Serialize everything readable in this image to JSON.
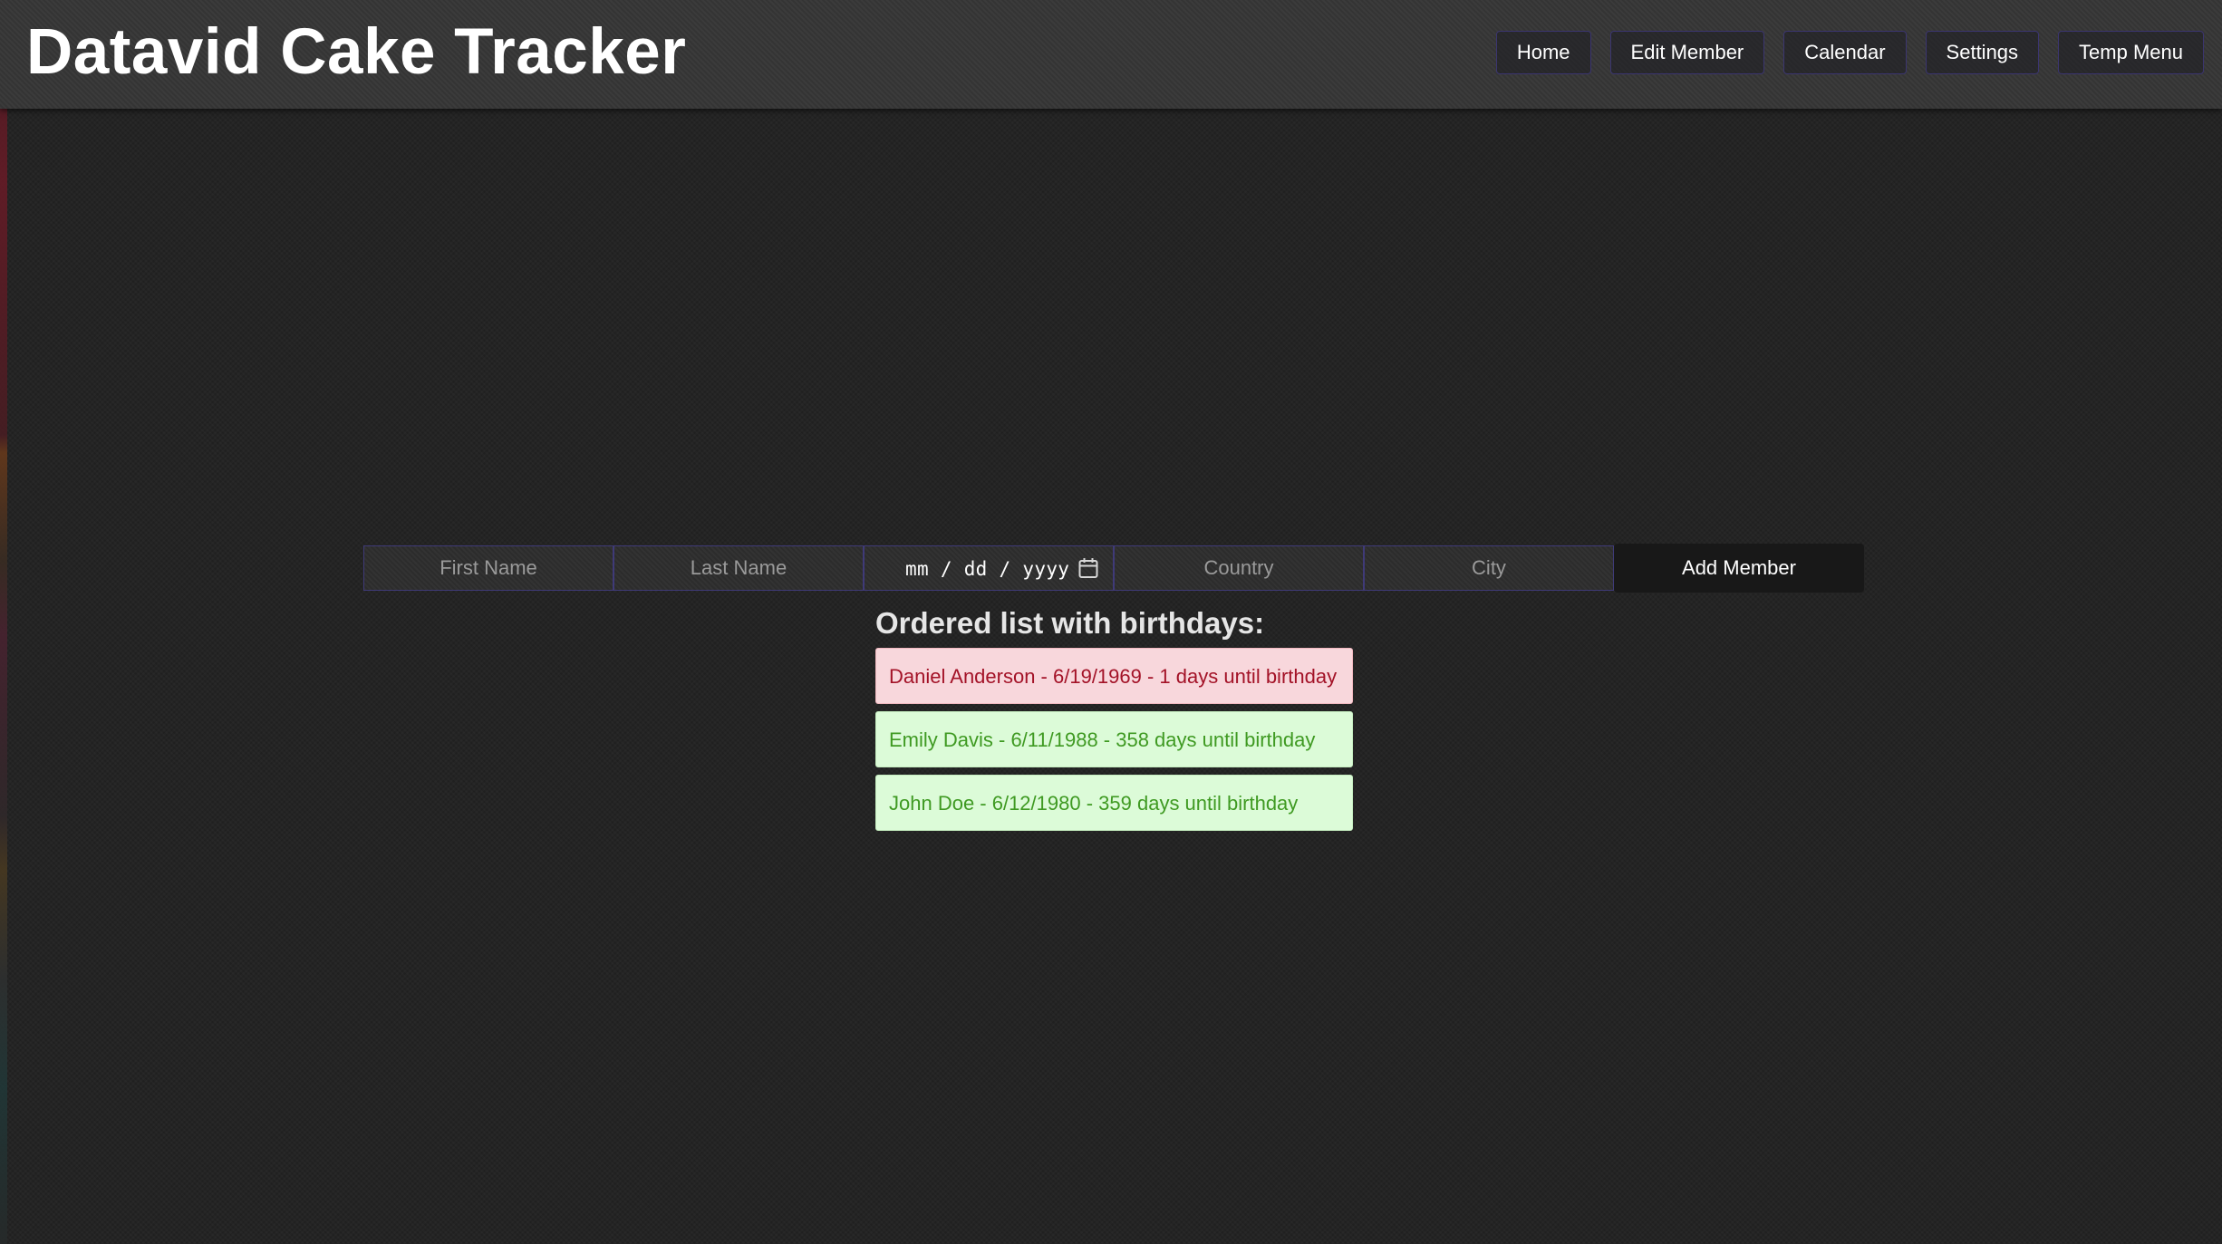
{
  "app": {
    "title": "Datavid Cake Tracker"
  },
  "nav": {
    "items": [
      {
        "label": "Home"
      },
      {
        "label": "Edit Member"
      },
      {
        "label": "Calendar"
      },
      {
        "label": "Settings"
      },
      {
        "label": "Temp Menu"
      }
    ]
  },
  "form": {
    "first_name_placeholder": "First Name",
    "last_name_placeholder": "Last Name",
    "date_placeholder": "mm / dd / yyyy",
    "date_icon": "calendar-icon",
    "country_placeholder": "Country",
    "city_placeholder": "City",
    "add_button_label": "Add Member"
  },
  "list": {
    "heading": "Ordered list with birthdays:",
    "items": [
      {
        "text": "Daniel Anderson - 6/19/1969 - 1 days until birthday",
        "status": "soon"
      },
      {
        "text": "Emily Davis - 6/11/1988 - 358 days until birthday",
        "status": "later"
      },
      {
        "text": "John Doe - 6/12/1980 - 359 days until birthday",
        "status": "later"
      }
    ]
  },
  "colors": {
    "soon_bg": "#f8d7dc",
    "soon_text": "#a31227",
    "later_bg": "#dcfbd8",
    "later_text": "#3f9a22",
    "field_border": "#3f3a78"
  }
}
